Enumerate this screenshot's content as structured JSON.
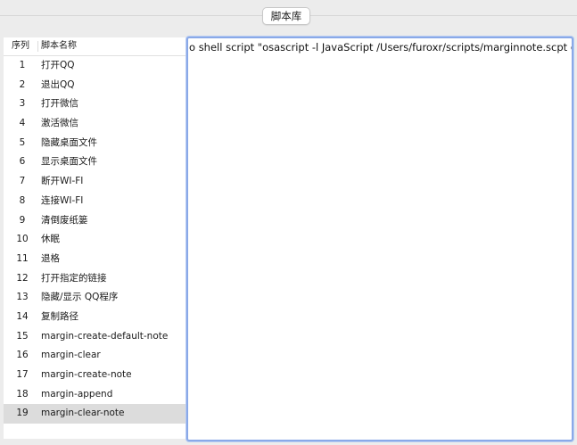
{
  "toolbar": {
    "library_button_label": "脚本库"
  },
  "list": {
    "headers": {
      "seq": "序列",
      "name": "脚本名称"
    },
    "rows": [
      {
        "seq": "1",
        "name": "打开QQ"
      },
      {
        "seq": "2",
        "name": "退出QQ"
      },
      {
        "seq": "3",
        "name": "打开微信"
      },
      {
        "seq": "4",
        "name": "激活微信"
      },
      {
        "seq": "5",
        "name": "隐藏桌面文件"
      },
      {
        "seq": "6",
        "name": "显示桌面文件"
      },
      {
        "seq": "7",
        "name": "断开WI-FI"
      },
      {
        "seq": "8",
        "name": "连接WI-FI"
      },
      {
        "seq": "9",
        "name": "清倒废纸篓"
      },
      {
        "seq": "10",
        "name": "休眠"
      },
      {
        "seq": "11",
        "name": "退格"
      },
      {
        "seq": "12",
        "name": "打开指定的链接"
      },
      {
        "seq": "13",
        "name": "隐藏/显示 QQ程序"
      },
      {
        "seq": "14",
        "name": "复制路径"
      },
      {
        "seq": "15",
        "name": "margin-create-default-note"
      },
      {
        "seq": "16",
        "name": "margin-clear"
      },
      {
        "seq": "17",
        "name": "margin-create-note"
      },
      {
        "seq": "18",
        "name": "margin-append"
      },
      {
        "seq": "19",
        "name": "margin-clear-note"
      }
    ],
    "selected_seq": "19"
  },
  "editor": {
    "content": "o shell script \"osascript -l JavaScript  /Users/furoxr/scripts/marginnote.scpt clear-note\""
  },
  "colors": {
    "selection": "#dcdcdc",
    "focus_ring": "#8aa9e8"
  }
}
